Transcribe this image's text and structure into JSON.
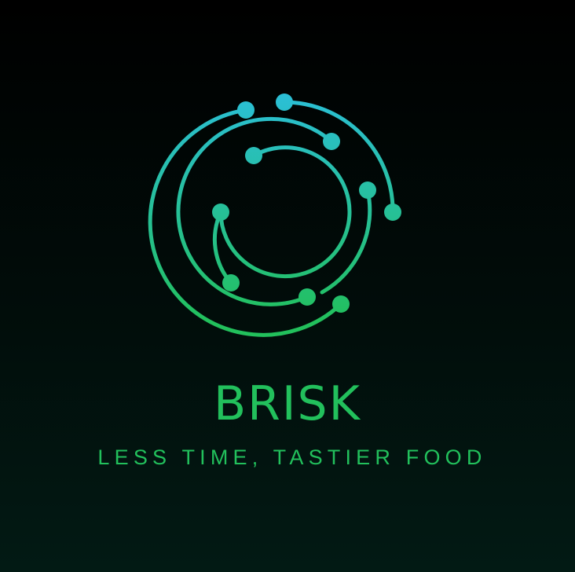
{
  "logo": {
    "icon": "circular-circuit-emblem-icon",
    "gradient_top": "#2bbfd6",
    "gradient_bottom": "#22c05c",
    "background_top": "#000000",
    "background_bottom": "#021a14"
  },
  "brand": {
    "name": "BRISK",
    "tagline": "LESS TIME, TASTIER FOOD",
    "color": "#22c05c"
  }
}
